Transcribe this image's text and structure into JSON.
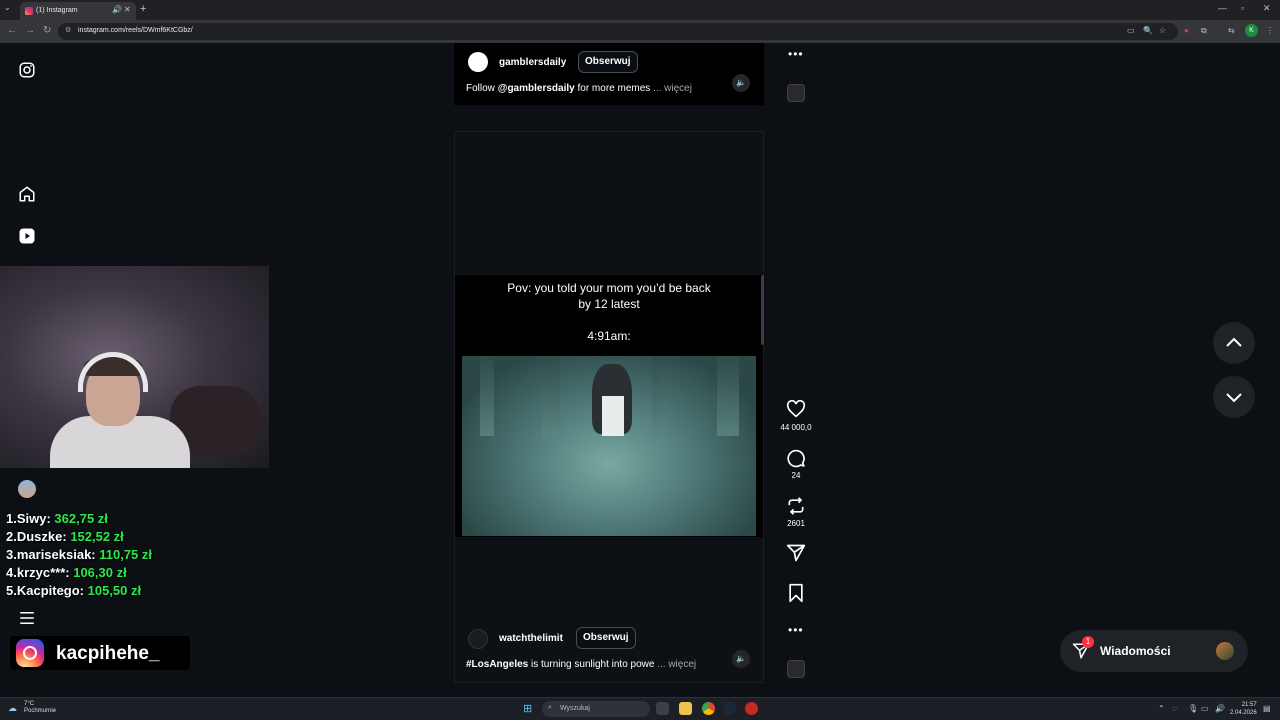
{
  "browser": {
    "tab_title": "(1) Instagram",
    "url": "instagram.com/reels/DWmf6KtCGbz/"
  },
  "reel_top": {
    "username": "gamblersdaily",
    "follow_label": "Obserwuj",
    "caption_prefix": "Follow ",
    "caption_mention": "@gamblersdaily",
    "caption_rest": " for more memes ",
    "caption_more": "... więcej"
  },
  "reel_main": {
    "video_line1": "Pov: you told your mom you’d be back",
    "video_line2": "by 12 latest",
    "video_line3": "4:91am:",
    "username": "watchthelimit",
    "follow_label": "Obserwuj",
    "caption_hashtag": "#LosAngeles",
    "caption_rest": " is turning sunlight into powe",
    "caption_more": "... więcej"
  },
  "actions": {
    "likes": "44 000,0",
    "comments": "24",
    "reposts": "2601"
  },
  "messages": {
    "label": "Wiadomości",
    "badge": "1"
  },
  "overlay": {
    "leaderboard": [
      {
        "name": "1.Siwy: ",
        "amount": "362,75 zł"
      },
      {
        "name": "2.Duszke: ",
        "amount": "152,52 zł"
      },
      {
        "name": "3.mariseksiak: ",
        "amount": "110,75 zł"
      },
      {
        "name": "4.krzyc***: ",
        "amount": "106,30 zł"
      },
      {
        "name": "5.Kacpitego: ",
        "amount": "105,50 zł"
      }
    ],
    "instagram_handle": "kacpihehe_"
  },
  "taskbar": {
    "weather_temp": "7°C",
    "weather_desc": "Pochmurnie",
    "search_placeholder": "Wyszukaj",
    "time": "21:57",
    "date": "2.04.2026"
  }
}
